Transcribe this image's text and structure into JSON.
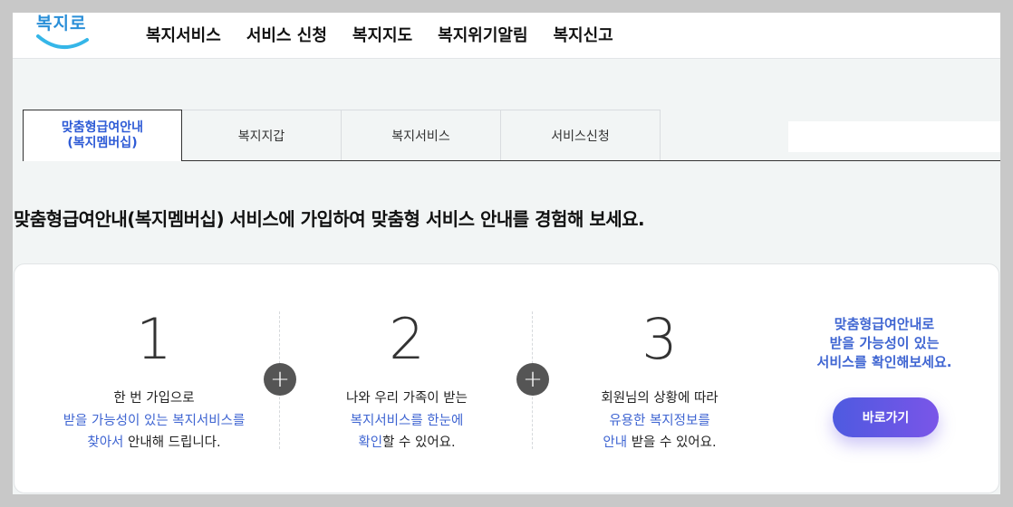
{
  "header": {
    "logo_text": "복지로",
    "nav": [
      "복지서비스",
      "서비스 신청",
      "복지지도",
      "복지위기알림",
      "복지신고"
    ]
  },
  "tabs": [
    {
      "label": "맞춤형급여안내\n(복지멤버십)",
      "active": true
    },
    {
      "label": "복지지갑",
      "active": false
    },
    {
      "label": "복지서비스",
      "active": false
    },
    {
      "label": "서비스신청",
      "active": false
    }
  ],
  "headline": "맞춤형급여안내(복지멤버십) 서비스에 가입하여 맞춤형 서비스 안내를 경험해 보세요.",
  "steps": [
    {
      "number": "1",
      "line1": "한 번 가입으로",
      "line2": "받을 가능성이 있는 복지서비스를",
      "line3_blue": "찾아서",
      "line3_rest": " 안내해 드립니다."
    },
    {
      "number": "2",
      "line1": "나와 우리 가족이 받는",
      "line2": "복지서비스를 한눈에",
      "line3_blue": "확인",
      "line3_rest": "할 수 있어요."
    },
    {
      "number": "3",
      "line1": "회원님의 상황에 따라",
      "line2": "유용한 복지정보를",
      "line3_blue": "안내",
      "line3_rest": " 받을 수 있어요."
    }
  ],
  "plus_symbol": "+",
  "cta": {
    "line1": "맞춤형급여안내로",
    "line2": "받을 가능성이 있는",
    "line3": "서비스를 확인해보세요.",
    "button_label": "바로가기"
  },
  "colors": {
    "accent_blue": "#3f65d2",
    "button_gradient_start": "#4e5ae0",
    "button_gradient_end": "#7a55e8",
    "logo_blue": "#2a8fd8"
  }
}
